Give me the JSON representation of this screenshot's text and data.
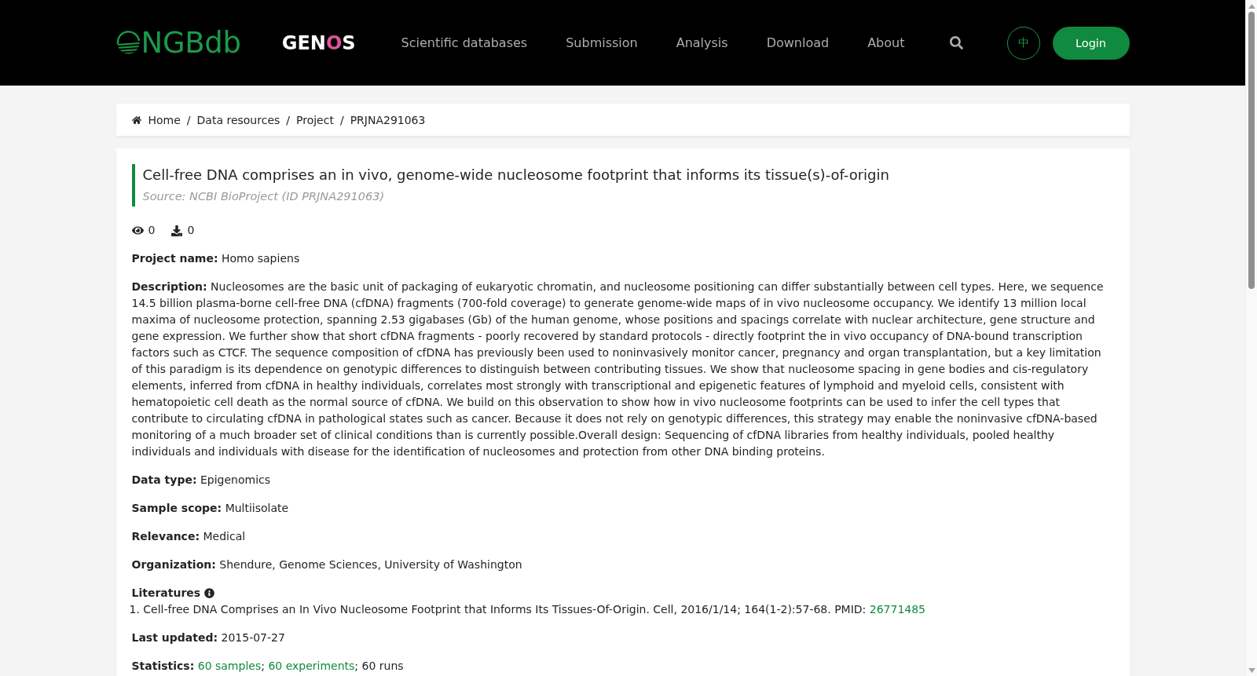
{
  "header": {
    "logo": {
      "text": "NGBdb"
    },
    "genos_logo": {
      "parts": [
        {
          "kind": "plain",
          "text": "GEN"
        },
        {
          "kind": "ring",
          "text": "O"
        },
        {
          "kind": "plain",
          "text": "S"
        }
      ]
    },
    "nav": [
      {
        "label": "Scientific databases"
      },
      {
        "label": "Submission"
      },
      {
        "label": "Analysis"
      },
      {
        "label": "Download"
      },
      {
        "label": "About"
      }
    ],
    "language_button": "中",
    "login_button": "Login"
  },
  "breadcrumb": [
    {
      "kind": "home",
      "label": "Home"
    },
    {
      "kind": "separator",
      "label": "/"
    },
    {
      "kind": "link",
      "label": "Data resources"
    },
    {
      "kind": "separator",
      "label": "/"
    },
    {
      "kind": "link",
      "label": "Project"
    },
    {
      "kind": "separator",
      "label": "/"
    },
    {
      "kind": "current",
      "label": "PRJNA291063"
    }
  ],
  "project": {
    "title": "Cell-free DNA comprises an in vivo, genome-wide nucleosome footprint that informs its tissue(s)-of-origin",
    "source": "Source: NCBI BioProject (ID PRJNA291063)",
    "stats": [
      {
        "kind": "views",
        "value": "0"
      },
      {
        "kind": "downloads",
        "value": "0"
      }
    ],
    "fields": [
      {
        "kind": "text",
        "text": "**Project name:** Homo sapiens"
      },
      {
        "kind": "text",
        "text": "**Description:** Nucleosomes are the basic unit of packaging of eukaryotic chromatin, and nucleosome positioning can differ substantially between cell types. Here, we sequence 14.5 billion plasma-borne cell-free DNA (cfDNA) fragments (700-fold coverage) to generate genome-wide maps of in vivo nucleosome occupancy. We identify 13 million local maxima of nucleosome protection, spanning 2.53 gigabases (Gb) of the human genome, whose positions and spacings correlate with nuclear architecture, gene structure and gene expression. We further show that short cfDNA fragments - poorly recovered by standard protocols - directly footprint the in vivo occupancy of DNA-bound transcription factors such as CTCF. The sequence composition of cfDNA has previously been used to noninvasively monitor cancer, pregnancy and organ transplantation, but a key limitation of this paradigm is its dependence on genotypic differences to distinguish between contributing tissues. We show that nucleosome spacing in gene bodies and cis-regulatory elements, inferred from cfDNA in healthy individuals, correlates most strongly with transcriptional and epigenetic features of lymphoid and myeloid cells, consistent with hematopoietic cell death as the normal source of cfDNA. We build on this observation to show how in vivo nucleosome footprints can be used to infer the cell types that contribute to circulating cfDNA in pathological states such as cancer. Because it does not rely on genotypic differences, this strategy may enable the noninvasive cfDNA-based monitoring of a much broader set of clinical conditions than is currently possible.Overall design: Sequencing of cfDNA libraries from healthy individuals, pooled healthy individuals and individuals with disease for the identification of nucleosomes and protection from other DNA binding proteins."
      },
      {
        "kind": "text",
        "text": "**Data type:** Epigenomics"
      },
      {
        "kind": "text",
        "text": "**Sample scope:** Multiisolate"
      },
      {
        "kind": "text",
        "text": "**Relevance:** Medical"
      },
      {
        "kind": "text",
        "text": "**Organization:** Shendure, Genome Sciences, University of Washington"
      },
      {
        "kind": "list",
        "label": "Literatures",
        "items": [
          {
            "number": "1.",
            "text": "Cell-free DNA Comprises an In Vivo Nucleosome Footprint that Informs Its Tissues-Of-Origin. Cell, 2016/1/14; 164(1-2):57-68. PMID:",
            "link": "26771485"
          }
        ]
      },
      {
        "kind": "text",
        "text": "**Last updated:** 2015-07-27"
      },
      {
        "kind": "links",
        "label": "Statistics:",
        "parts": [
          {
            "kind": "link",
            "text": "60 samples"
          },
          {
            "kind": "plain",
            "text": ";"
          },
          {
            "kind": "link",
            "text": "60 experiments"
          },
          {
            "kind": "plain",
            "text": "; 60 runs"
          }
        ]
      }
    ]
  }
}
